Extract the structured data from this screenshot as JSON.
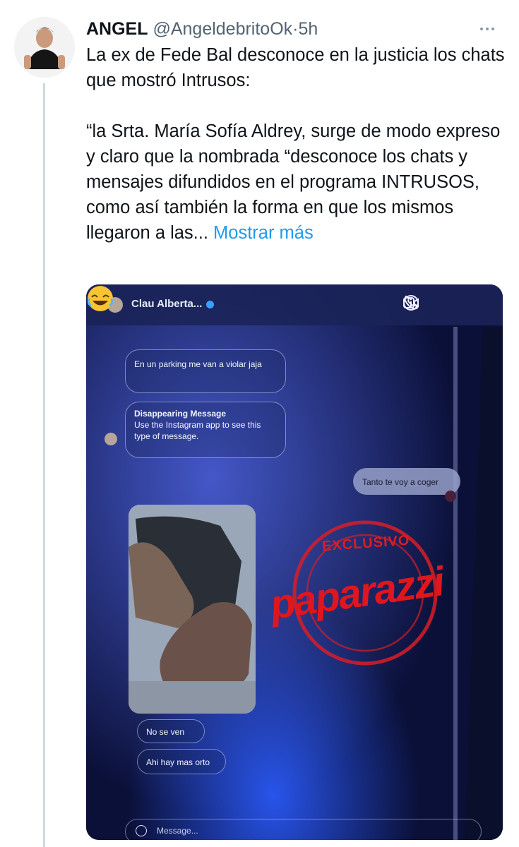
{
  "tweet": {
    "author_name": "ANGEL",
    "handle": "@AngeldebritoOk",
    "separator": "·",
    "time": "5h",
    "text_line1": "La ex de Fede Bal desconoce en la justicia los chats que mostró Intrusos:",
    "text_quote": "“la Srta. María Sofía Aldrey, surge de modo expreso y claro que la nombrada “desconoce los chats y mensajes difundidos en el programa INTRUSOS, como así también la forma en que los mismos llegaron a las...",
    "show_more": "Mostrar más",
    "more_icon": "more-horizontal-icon"
  },
  "media": {
    "chat": {
      "contact_name": "Clau Alberta...",
      "icons": [
        "phone-icon",
        "video-icon",
        "info-icon"
      ],
      "messages": {
        "parking": "En un parking me van a violar jaja",
        "disappearing_title": "Disappearing Message",
        "disappearing_body": "Use the Instagram app to see this type of message.",
        "sent": "Tanto te voy a coger",
        "no_se_ven": "No se ven",
        "ahi_hay": "Ahi hay mas orto"
      },
      "composer_placeholder": "Message..."
    },
    "stamp": {
      "top_text": "EXCLUSIVO",
      "main_text": "paparazzi",
      "color": "#e0161e"
    }
  }
}
